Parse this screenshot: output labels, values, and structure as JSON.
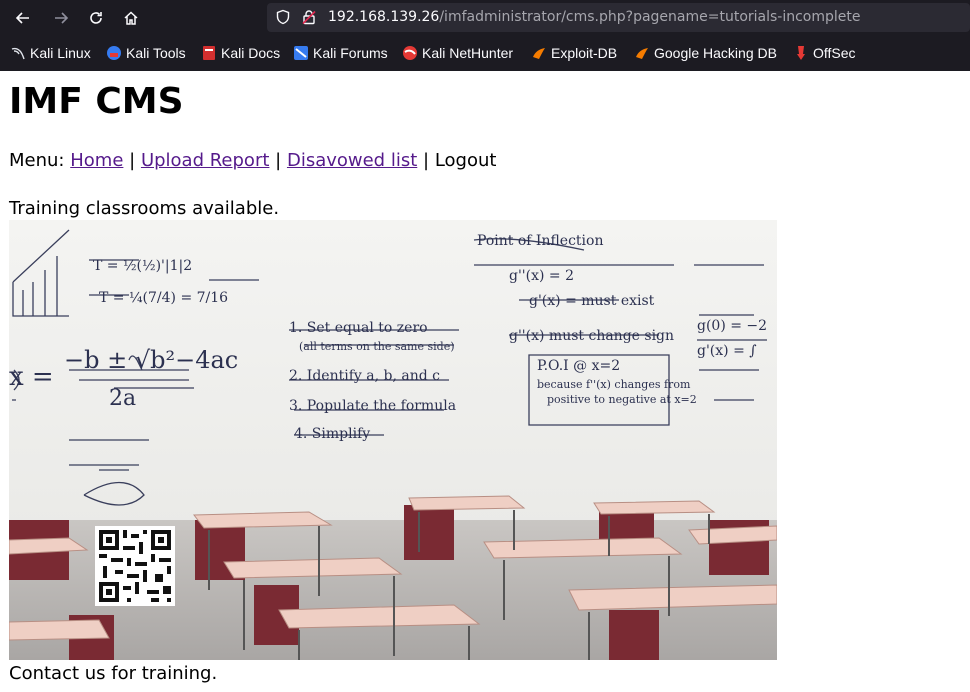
{
  "browser": {
    "url_host": "192.168.139.26",
    "url_path": "/imfadministrator/cms.php?pagename=tutorials-incomplete",
    "bookmarks": [
      {
        "label": "Kali Linux",
        "icon": "kali-dragon-icon"
      },
      {
        "label": "Kali Tools",
        "icon": "kali-tools-icon"
      },
      {
        "label": "Kali Docs",
        "icon": "kali-docs-icon"
      },
      {
        "label": "Kali Forums",
        "icon": "kali-forums-icon"
      },
      {
        "label": "Kali NetHunter",
        "icon": "nethunter-icon"
      },
      {
        "label": "Exploit-DB",
        "icon": "exploit-db-icon"
      },
      {
        "label": "Google Hacking DB",
        "icon": "ghdb-icon"
      },
      {
        "label": "OffSec",
        "icon": "offsec-icon"
      }
    ]
  },
  "page": {
    "title": "IMF CMS",
    "menu_prefix": "Menu:",
    "menu": {
      "home": "Home",
      "upload": "Upload Report",
      "disavowed": "Disavowed list",
      "logout": "Logout"
    },
    "separator": "|",
    "training_text": "Training classrooms available.",
    "contact_text": "Contact us for training.",
    "whiteboard": {
      "formula": "x = -b ± √b²-4ac / 2a",
      "steps": [
        "1. Set equal to zero",
        "2. Identify a, b, and c",
        "3. Populate the formula",
        "4. Simplify"
      ],
      "notes_title": "Point of Inflection",
      "poi": "P.O.I @ x=2"
    }
  }
}
